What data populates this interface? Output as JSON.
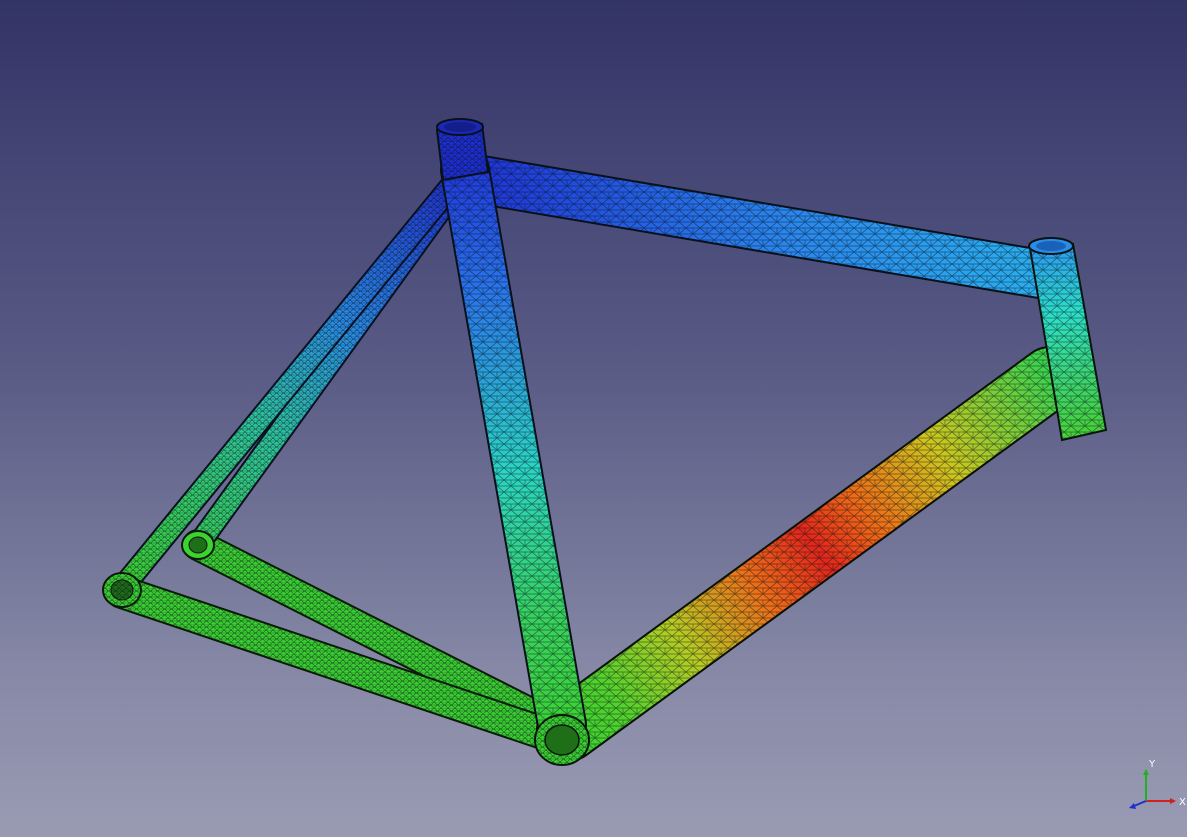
{
  "viewer": {
    "background_top": "#333466",
    "background_bottom": "#9a9bb3"
  },
  "model": {
    "name": "bicycle-frame-mesh",
    "colormap": [
      "#1f2fd6",
      "#2a8ff0",
      "#2bd7c8",
      "#36d25a",
      "#62d02a",
      "#d8b81c",
      "#f06a14",
      "#e8281a"
    ]
  },
  "axis_triad": {
    "x_label": "X",
    "y_label": "Y",
    "z_label": "",
    "x_color": "#d02020",
    "y_color": "#20b020",
    "z_color": "#2030d0"
  }
}
